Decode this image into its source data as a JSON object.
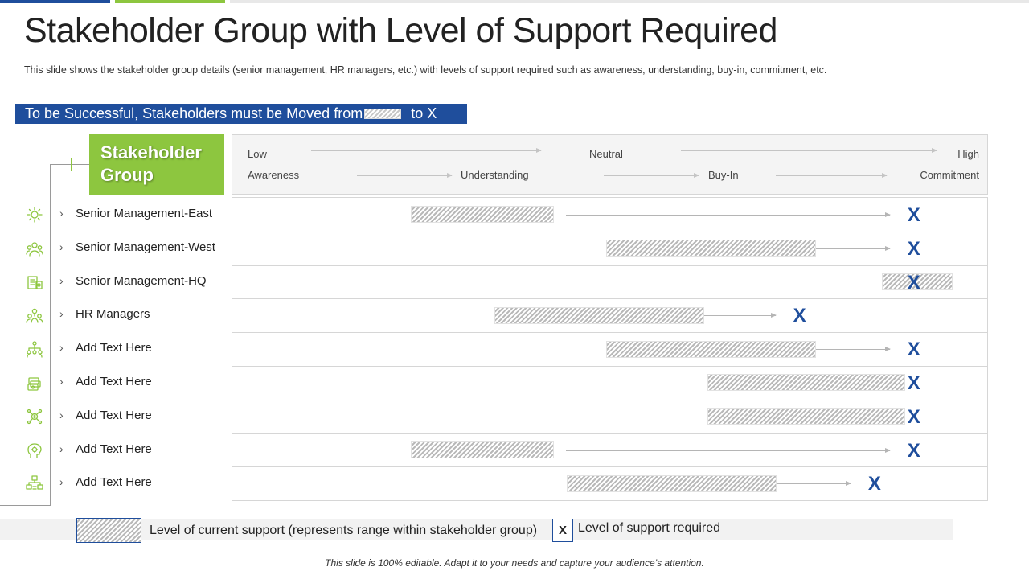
{
  "title": "Stakeholder Group with Level of Support Required",
  "subtitle": "This slide shows the stakeholder group details (senior management, HR managers, etc.) with levels of support required such as awareness, understanding, buy-in, commitment, etc.",
  "banner": {
    "text_before": "To be Successful, Stakeholders must be Moved from",
    "text_after": "to X"
  },
  "group_header": "Stakeholder Group",
  "scale_top": [
    "Low",
    "Neutral",
    "High"
  ],
  "scale_bottom": [
    "Awareness",
    "Understanding",
    "Buy-In",
    "Commitment"
  ],
  "rows": [
    {
      "label": "Senior Management-East",
      "icon": "gear-person-icon",
      "current_from": 0.237,
      "current_to": 0.426,
      "required": 0.902
    },
    {
      "label": "Senior Management-West",
      "icon": "team-icon",
      "current_from": 0.495,
      "current_to": 0.773,
      "required": 0.902
    },
    {
      "label": "Senior Management-HQ",
      "icon": "money-building-icon",
      "current_from": 0.86,
      "current_to": 0.953,
      "required": 0.902
    },
    {
      "label": "HR Managers",
      "icon": "group-icon",
      "current_from": 0.347,
      "current_to": 0.625,
      "required": 0.751
    },
    {
      "label": "Add Text Here",
      "icon": "hierarchy-icon",
      "current_from": 0.495,
      "current_to": 0.773,
      "required": 0.902
    },
    {
      "label": "Add Text Here",
      "icon": "cash-stack-icon",
      "current_from": 0.629,
      "current_to": 0.891,
      "required": 0.902
    },
    {
      "label": "Add Text Here",
      "icon": "dollar-network-icon",
      "current_from": 0.629,
      "current_to": 0.891,
      "required": 0.902
    },
    {
      "label": "Add Text Here",
      "icon": "head-gear-icon",
      "current_from": 0.237,
      "current_to": 0.426,
      "required": 0.902
    },
    {
      "label": "Add Text Here",
      "icon": "org-chart-icon",
      "current_from": 0.443,
      "current_to": 0.721,
      "required": 0.85
    }
  ],
  "legend": {
    "current": "Level of current support (represents range within stakeholder group)",
    "required_mark": "X",
    "required": "Level of support required"
  },
  "footer": "This slide is 100% editable. Adapt it to your needs and capture your audience’s attention.",
  "colors": {
    "blue": "#1f4e9c",
    "green": "#8dc63f",
    "icon_green": "#8dc63f"
  }
}
